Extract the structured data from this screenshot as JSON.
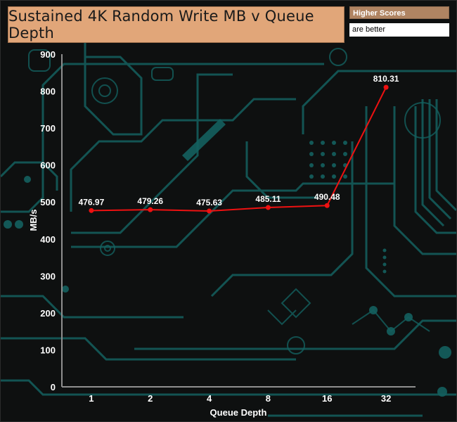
{
  "header": {
    "title": "Sustained 4K Random Write MB v Queue Depth",
    "legend_line1": "Higher Scores",
    "legend_line2": "are better"
  },
  "colors": {
    "series": "#ee1111",
    "title_bg": "#e1a679",
    "legend_bg": "#b08462",
    "background": "#0e1010",
    "circuit": "#14605f"
  },
  "chart_data": {
    "type": "line",
    "title": "Sustained 4K Random Write MB v Queue Depth",
    "xlabel": "Queue Depth",
    "ylabel": "MB/s",
    "categories": [
      "1",
      "2",
      "4",
      "8",
      "16",
      "32"
    ],
    "series": [
      {
        "values": [
          476.97,
          479.26,
          475.63,
          485.11,
          490.48,
          810.31
        ]
      }
    ],
    "data_labels": [
      "476.97",
      "479.26",
      "475.63",
      "485.11",
      "490.48",
      "810.31"
    ],
    "ylim": [
      0,
      900
    ],
    "yticks": [
      0,
      100,
      200,
      300,
      400,
      500,
      600,
      700,
      800,
      900
    ],
    "grid": false,
    "legend": "top-right"
  }
}
